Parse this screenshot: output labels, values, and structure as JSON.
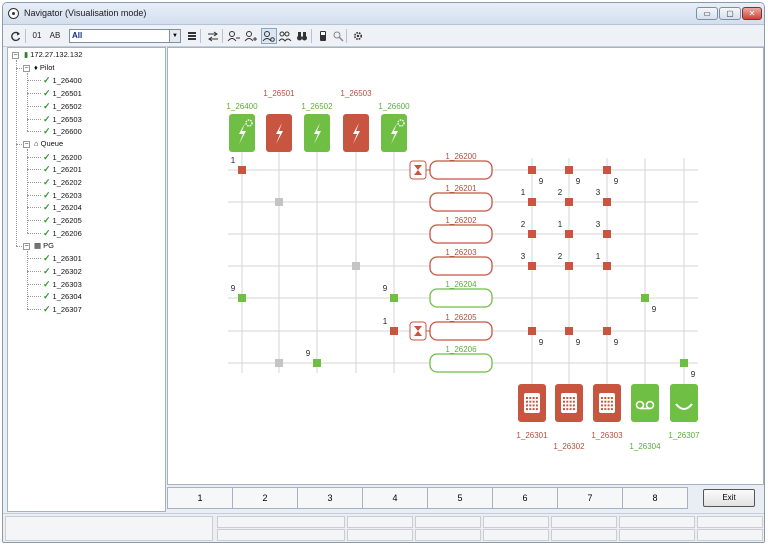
{
  "window": {
    "title": "Navigator (Visualisation mode)"
  },
  "window_buttons": {
    "minimize": "▭",
    "maximize": "▢",
    "close": "✕"
  },
  "toolbar": {
    "refresh_icon": "refresh-icon",
    "id_toggle": "01",
    "name_toggle": "AB",
    "filter_value": "All",
    "filter_dropdown": "▼"
  },
  "tree": {
    "root": "172.27.132.132",
    "groups": [
      {
        "label": "Pilot",
        "items": [
          "1_26400",
          "1_26501",
          "1_26502",
          "1_26503",
          "1_26600"
        ]
      },
      {
        "label": "Queue",
        "items": [
          "1_26200",
          "1_26201",
          "1_26202",
          "1_26203",
          "1_26204",
          "1_26205",
          "1_26206"
        ]
      },
      {
        "label": "PG",
        "items": [
          "1_26301",
          "1_26302",
          "1_26303",
          "1_26304",
          "1_26307"
        ]
      }
    ]
  },
  "diagram": {
    "pilots": [
      {
        "label": "1_26400",
        "state": "green",
        "icon": "lightning-gear-icon"
      },
      {
        "label": "1_26501",
        "state": "red",
        "icon": "lightning-icon"
      },
      {
        "label": "1_26502",
        "state": "green",
        "icon": "lightning-icon"
      },
      {
        "label": "1_26503",
        "state": "red",
        "icon": "lightning-icon"
      },
      {
        "label": "1_26600",
        "state": "green",
        "icon": "lightning-gear-icon"
      }
    ],
    "queues": [
      {
        "label": "1_26200",
        "state": "red",
        "hourglass": true
      },
      {
        "label": "1_26201",
        "state": "red",
        "hourglass": false
      },
      {
        "label": "1_26202",
        "state": "red",
        "hourglass": false
      },
      {
        "label": "1_26203",
        "state": "red",
        "hourglass": false
      },
      {
        "label": "1_26204",
        "state": "green",
        "hourglass": false
      },
      {
        "label": "1_26205",
        "state": "red",
        "hourglass": true
      },
      {
        "label": "1_26206",
        "state": "green",
        "hourglass": false
      }
    ],
    "groups": [
      {
        "label": "1_26301",
        "state": "red",
        "icon": "phones-icon"
      },
      {
        "label": "1_26302",
        "state": "red",
        "icon": "phones-icon"
      },
      {
        "label": "1_26303",
        "state": "red",
        "icon": "phones-icon"
      },
      {
        "label": "1_26304",
        "state": "green",
        "icon": "voicemail-icon"
      },
      {
        "label": "1_26307",
        "state": "green",
        "icon": "smile-icon"
      }
    ],
    "pilot_links": [
      {
        "pilot": 0,
        "queue": 0,
        "state": "red",
        "num": "1"
      },
      {
        "pilot": 1,
        "queue": 1,
        "state": "grey",
        "num": ""
      },
      {
        "pilot": 3,
        "queue": 3,
        "state": "grey",
        "num": ""
      },
      {
        "pilot": 0,
        "queue": 4,
        "state": "green",
        "num": "9"
      },
      {
        "pilot": 4,
        "queue": 4,
        "state": "green",
        "num": "9"
      },
      {
        "pilot": 4,
        "queue": 5,
        "state": "red",
        "num": "1"
      },
      {
        "pilot": 1,
        "queue": 6,
        "state": "grey",
        "num": ""
      },
      {
        "pilot": 2,
        "queue": 6,
        "state": "green",
        "num": "9"
      }
    ],
    "group_links": [
      {
        "queue": 0,
        "group": 0,
        "state": "red",
        "num": "9",
        "side": "right"
      },
      {
        "queue": 0,
        "group": 1,
        "state": "red",
        "num": "9",
        "side": "right"
      },
      {
        "queue": 0,
        "group": 2,
        "state": "red",
        "num": "9",
        "side": "right"
      },
      {
        "queue": 1,
        "group": 0,
        "state": "red",
        "num": "1",
        "side": "left"
      },
      {
        "queue": 1,
        "group": 1,
        "state": "red",
        "num": "2",
        "side": "left"
      },
      {
        "queue": 1,
        "group": 2,
        "state": "red",
        "num": "3",
        "side": "left"
      },
      {
        "queue": 2,
        "group": 0,
        "state": "red",
        "num": "2",
        "side": "left"
      },
      {
        "queue": 2,
        "group": 1,
        "state": "red",
        "num": "1",
        "side": "left"
      },
      {
        "queue": 2,
        "group": 2,
        "state": "red",
        "num": "3",
        "side": "left"
      },
      {
        "queue": 3,
        "group": 0,
        "state": "red",
        "num": "3",
        "side": "left"
      },
      {
        "queue": 3,
        "group": 1,
        "state": "red",
        "num": "2",
        "side": "left"
      },
      {
        "queue": 3,
        "group": 2,
        "state": "red",
        "num": "1",
        "side": "left"
      },
      {
        "queue": 4,
        "group": 3,
        "state": "green",
        "num": "9",
        "side": "right"
      },
      {
        "queue": 5,
        "group": 0,
        "state": "red",
        "num": "9",
        "side": "right"
      },
      {
        "queue": 5,
        "group": 1,
        "state": "red",
        "num": "9",
        "side": "right"
      },
      {
        "queue": 5,
        "group": 2,
        "state": "red",
        "num": "9",
        "side": "right"
      },
      {
        "queue": 6,
        "group": 4,
        "state": "green",
        "num": "9",
        "side": "right"
      }
    ],
    "colors": {
      "red": "#c8553f",
      "green": "#6fbf45",
      "grey": "#c4c4c4",
      "grid": "#d5d5d5",
      "red_text": "#b0503c",
      "green_text": "#5cae3a"
    }
  },
  "tabs": [
    "1",
    "2",
    "3",
    "4",
    "5",
    "6",
    "7",
    "8"
  ],
  "exit_label": "Exit"
}
